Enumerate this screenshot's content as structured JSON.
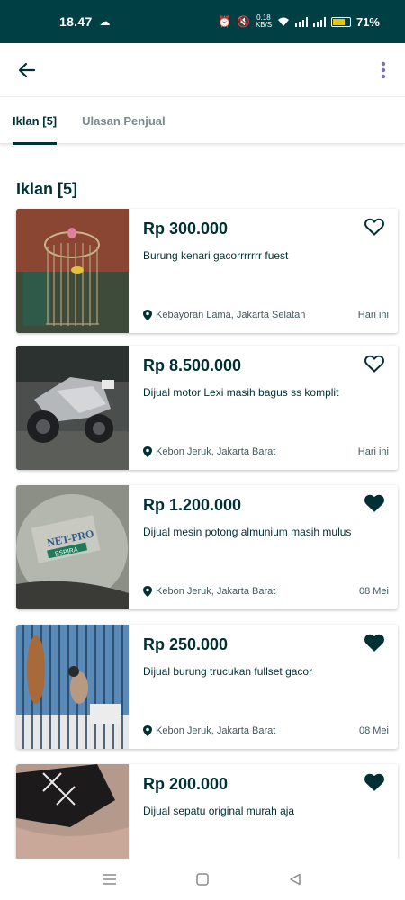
{
  "status_bar": {
    "time": "18.47",
    "network_speed": "0.18 KB/S",
    "battery_pct": "71%",
    "battery_level": 0.71
  },
  "app_bar": {
    "back_icon": "arrow-left-icon",
    "more_icon": "more-vert-icon"
  },
  "tabs": [
    {
      "label": "Iklan [5]",
      "active": true
    },
    {
      "label": "Ulasan Penjual",
      "active": false
    }
  ],
  "section_title": "Iklan [5]",
  "listings": [
    {
      "price": "Rp 300.000",
      "title": "Burung kenari gacorrrrrrr fuest",
      "location": "Kebayoran Lama, Jakarta Selatan",
      "date": "Hari ini",
      "favorited": false
    },
    {
      "price": "Rp 8.500.000",
      "title": "Dijual motor Lexi masih bagus ss komplit",
      "location": "Kebon Jeruk, Jakarta Barat",
      "date": "Hari ini",
      "favorited": false
    },
    {
      "price": "Rp 1.200.000",
      "title": "Dijual mesin potong almunium masih mulus",
      "location": "Kebon Jeruk, Jakarta Barat",
      "date": "08 Mei",
      "favorited": true
    },
    {
      "price": "Rp 250.000",
      "title": "Dijual burung trucukan fullset gacor",
      "location": "Kebon Jeruk, Jakarta Barat",
      "date": "08 Mei",
      "favorited": true
    },
    {
      "price": "Rp 200.000",
      "title": "Dijual sepatu original murah aja",
      "location": "",
      "date": "",
      "favorited": true
    }
  ],
  "thumb_labels": {
    "machine_brand": "NET-PRO",
    "machine_model": "ESPIRA"
  },
  "colors": {
    "primary": "#002f34",
    "status_bar_bg": "#003f44",
    "battery": "#f2c200"
  }
}
